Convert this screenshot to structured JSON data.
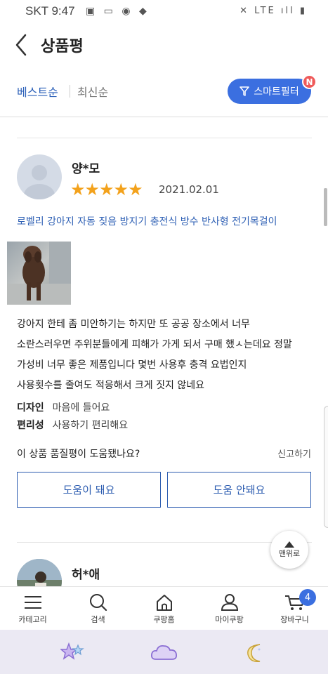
{
  "status_bar": {
    "carrier_time": "SKT 9:47",
    "left_icons": "▣ ▭ ◉ ◆",
    "right_icons": "✕ LTE ıll ▮"
  },
  "header": {
    "title": "상품평"
  },
  "sort": {
    "best": "베스트순",
    "newest": "최신순",
    "smart_filter": "스마트필터",
    "filter_badge": "N"
  },
  "review1": {
    "author": "양*모",
    "rating": 5,
    "stars_text": "★★★★★",
    "date": "2021.02.01",
    "product": "로벨리 강아지 자동 짖음 방지기 충전식 방수 반사형 전기목걸이",
    "body_lines": [
      "강아지 한테 좀 미안하기는 하지만 또 공공 장소에서 너무",
      "소란스러우면 주위분들에게 피해가 가게 되서 구매 했ㅅ는데요 정말",
      "가성비 너무 좋은 제품입니다 몇번 사용후 충격 요법인지",
      "사용횟수를 줄여도 적응해서 크게 짓지 않네요"
    ],
    "attrs": [
      {
        "key": "디자인",
        "value": "마음에 들어요"
      },
      {
        "key": "편리성",
        "value": "사용하기 편리해요"
      }
    ],
    "helpful_question": "이 상품 품질평이 도움됐나요?",
    "report": "신고하기",
    "helpful_yes": "도움이 돼요",
    "helpful_no": "도움 안돼요"
  },
  "review2": {
    "author": "허*애"
  },
  "scroll_top": {
    "label": "맨위로"
  },
  "bottom_nav": {
    "items": [
      {
        "label": "카테고리",
        "icon": "menu-icon"
      },
      {
        "label": "검색",
        "icon": "search-icon"
      },
      {
        "label": "쿠팡홈",
        "icon": "home-icon"
      },
      {
        "label": "마이쿠팡",
        "icon": "user-icon"
      },
      {
        "label": "장바구니",
        "icon": "cart-icon"
      }
    ],
    "cart_count": "4"
  },
  "colors": {
    "accent": "#3b6fe0",
    "star": "#f3a21c",
    "link_blue": "#2d5fb4",
    "badge_red": "#ef5a5a"
  }
}
